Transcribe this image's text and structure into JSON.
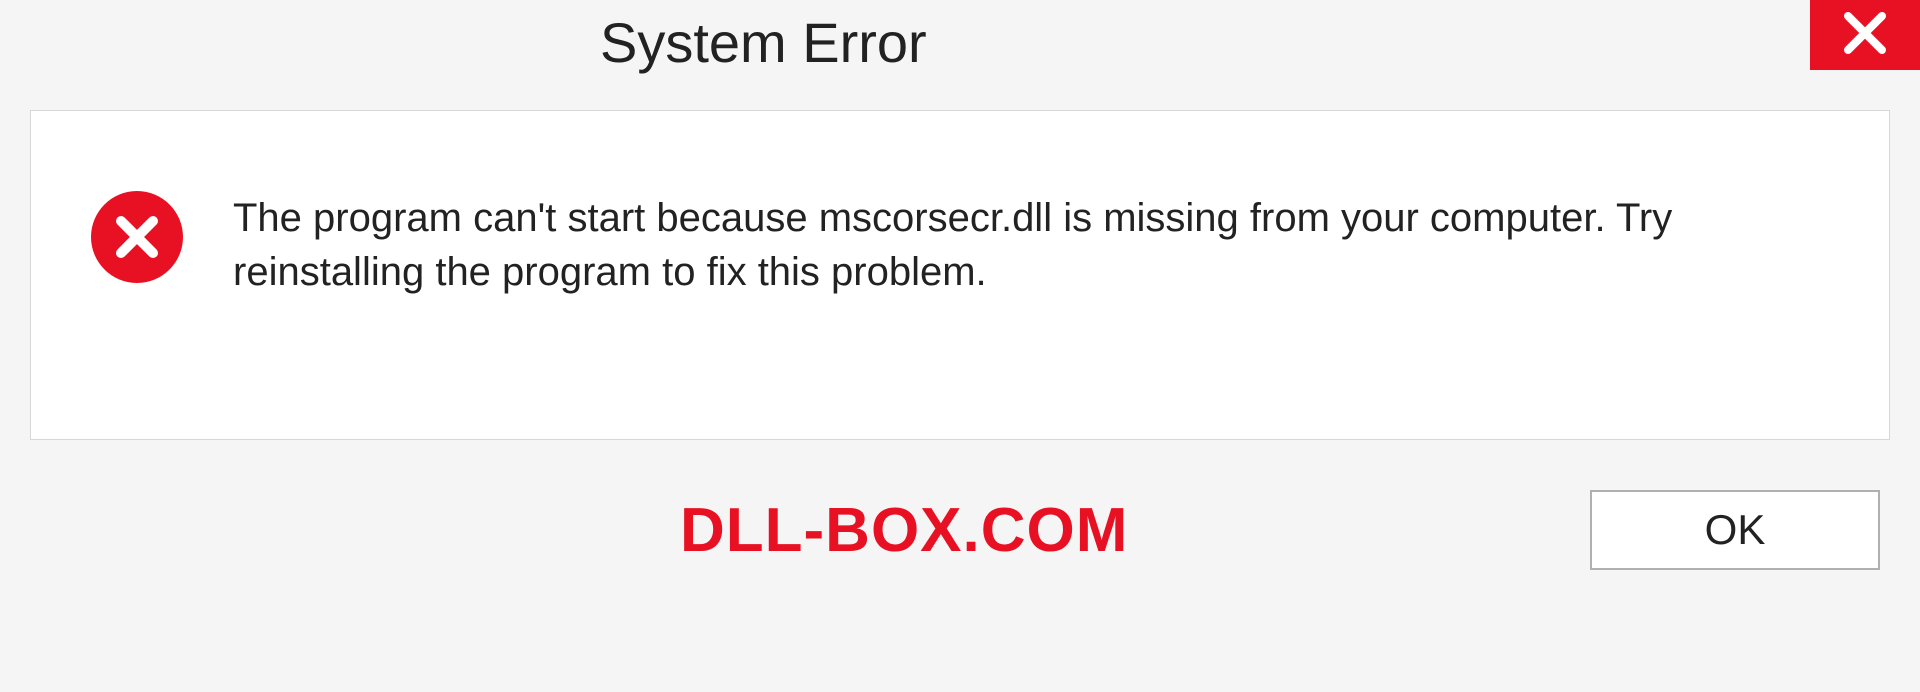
{
  "dialog": {
    "title": "System Error",
    "message": "The program can't start because mscorsecr.dll is missing from your computer. Try reinstalling the program to fix this problem.",
    "ok_label": "OK",
    "watermark": "DLL-BOX.COM"
  },
  "colors": {
    "error": "#e81123",
    "background": "#f5f5f5",
    "panel": "#ffffff"
  }
}
